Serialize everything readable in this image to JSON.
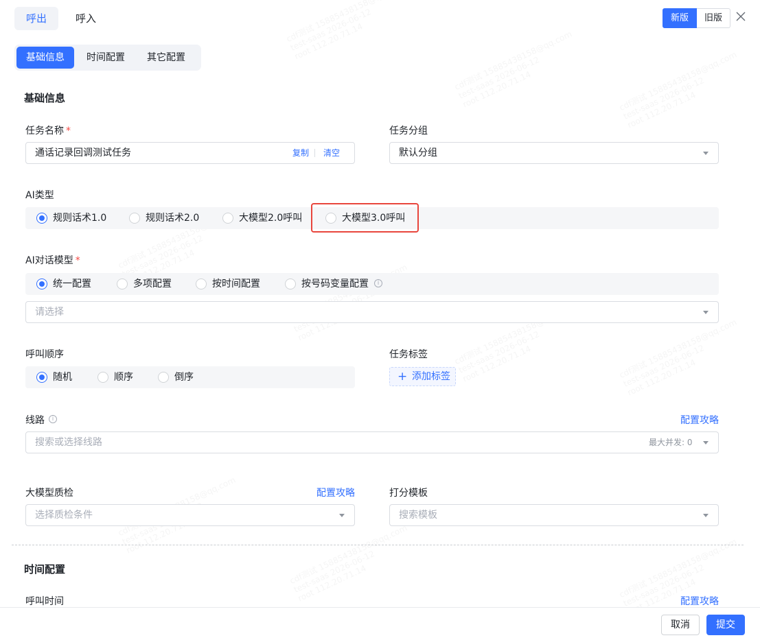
{
  "top_tabs": [
    {
      "label": "呼出",
      "active": true
    },
    {
      "label": "呼入",
      "active": false
    }
  ],
  "version": {
    "new_label": "新版",
    "old_label": "旧版"
  },
  "section_tabs": [
    {
      "label": "基础信息",
      "active": true
    },
    {
      "label": "时间配置",
      "active": false
    },
    {
      "label": "其它配置",
      "active": false
    }
  ],
  "basic": {
    "title": "基础信息",
    "task_name": {
      "label": "任务名称",
      "value": "通话记录回调测试任务",
      "copy": "复制",
      "clear": "清空"
    },
    "task_group": {
      "label": "任务分组",
      "value": "默认分组"
    },
    "ai_type": {
      "label": "AI类型",
      "options": [
        "规则话术1.0",
        "规则话术2.0",
        "大模型2.0呼叫",
        "大模型3.0呼叫"
      ],
      "selected": "规则话术1.0"
    },
    "ai_model": {
      "label": "AI对话模型",
      "options": [
        "统一配置",
        "多项配置",
        "按时间配置",
        "按号码变量配置"
      ],
      "selected": "统一配置",
      "placeholder": "请选择"
    },
    "call_order": {
      "label": "呼叫顺序",
      "options": [
        "随机",
        "顺序",
        "倒序"
      ],
      "selected": "随机"
    },
    "task_tags": {
      "label": "任务标签",
      "add_label": "添加标签"
    },
    "line": {
      "label": "线路",
      "guide": "配置攻略",
      "placeholder": "搜索或选择线路",
      "max_concurrency": "最大并发: 0"
    },
    "llm_qc": {
      "label": "大模型质检",
      "guide": "配置攻略",
      "placeholder": "选择质检条件"
    },
    "score_template": {
      "label": "打分模板",
      "placeholder": "搜索模板"
    }
  },
  "time_config": {
    "title": "时间配置",
    "call_time": {
      "label": "呼叫时间",
      "guide": "配置攻略"
    }
  },
  "footer": {
    "cancel": "取消",
    "submit": "提交"
  },
  "watermark_lines": [
    "cdf测试 15885438158@qq.com",
    "test-saas 2026-06-12",
    "root 112.20.71.14"
  ],
  "colors": {
    "primary": "#3370ff",
    "required": "#f54a45",
    "highlight": "#e8453c"
  }
}
